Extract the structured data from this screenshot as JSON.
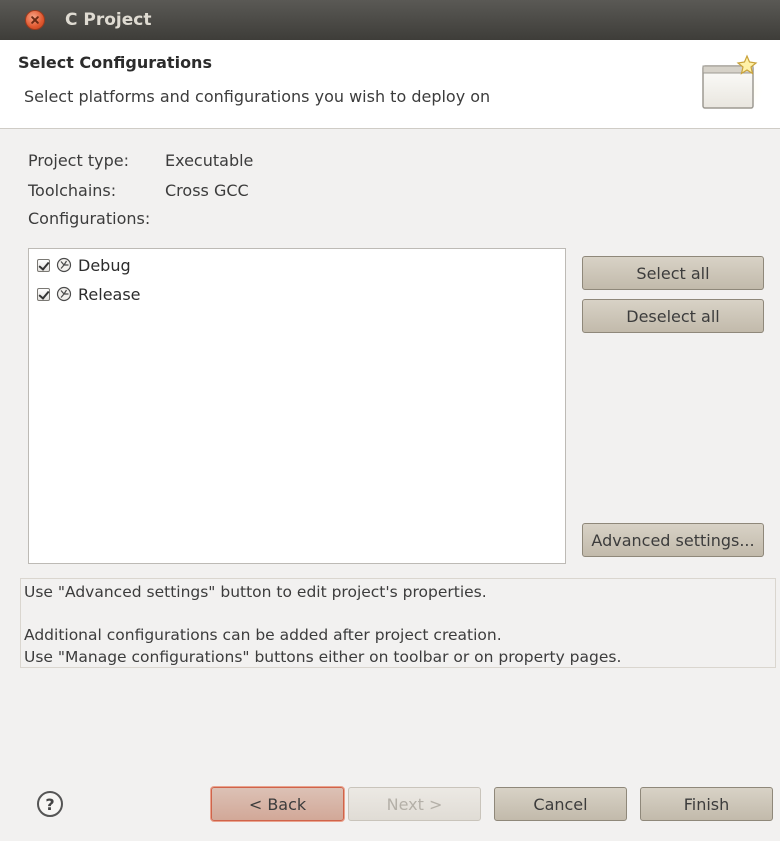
{
  "window": {
    "title": "C Project"
  },
  "header": {
    "title": "Select Configurations",
    "description": "Select platforms and configurations you wish to deploy on",
    "graphic_icon": "wizard-banner-icon"
  },
  "info": {
    "project_type_label": "Project type:",
    "project_type_value": "Executable",
    "toolchains_label": "Toolchains:",
    "toolchains_value": "Cross GCC",
    "configurations_label": "Configurations:"
  },
  "configurations": [
    {
      "label": "Debug",
      "checked": true,
      "icon": "build-config-icon"
    },
    {
      "label": "Release",
      "checked": true,
      "icon": "build-config-icon"
    }
  ],
  "side_buttons": {
    "select_all": "Select all",
    "deselect_all": "Deselect all",
    "advanced": "Advanced settings..."
  },
  "messages": {
    "line1": "Use \"Advanced settings\" button to edit project's properties.",
    "line2": "Additional configurations can be added after project creation.",
    "line3": "Use \"Manage configurations\" buttons either on toolbar or on property pages."
  },
  "footer": {
    "help": "?",
    "back": "< Back",
    "next": "Next >",
    "cancel": "Cancel",
    "finish": "Finish"
  },
  "colors": {
    "titlebar": "#3e3d39",
    "close_button": "#e0582f",
    "focus_border": "#d0634a"
  }
}
